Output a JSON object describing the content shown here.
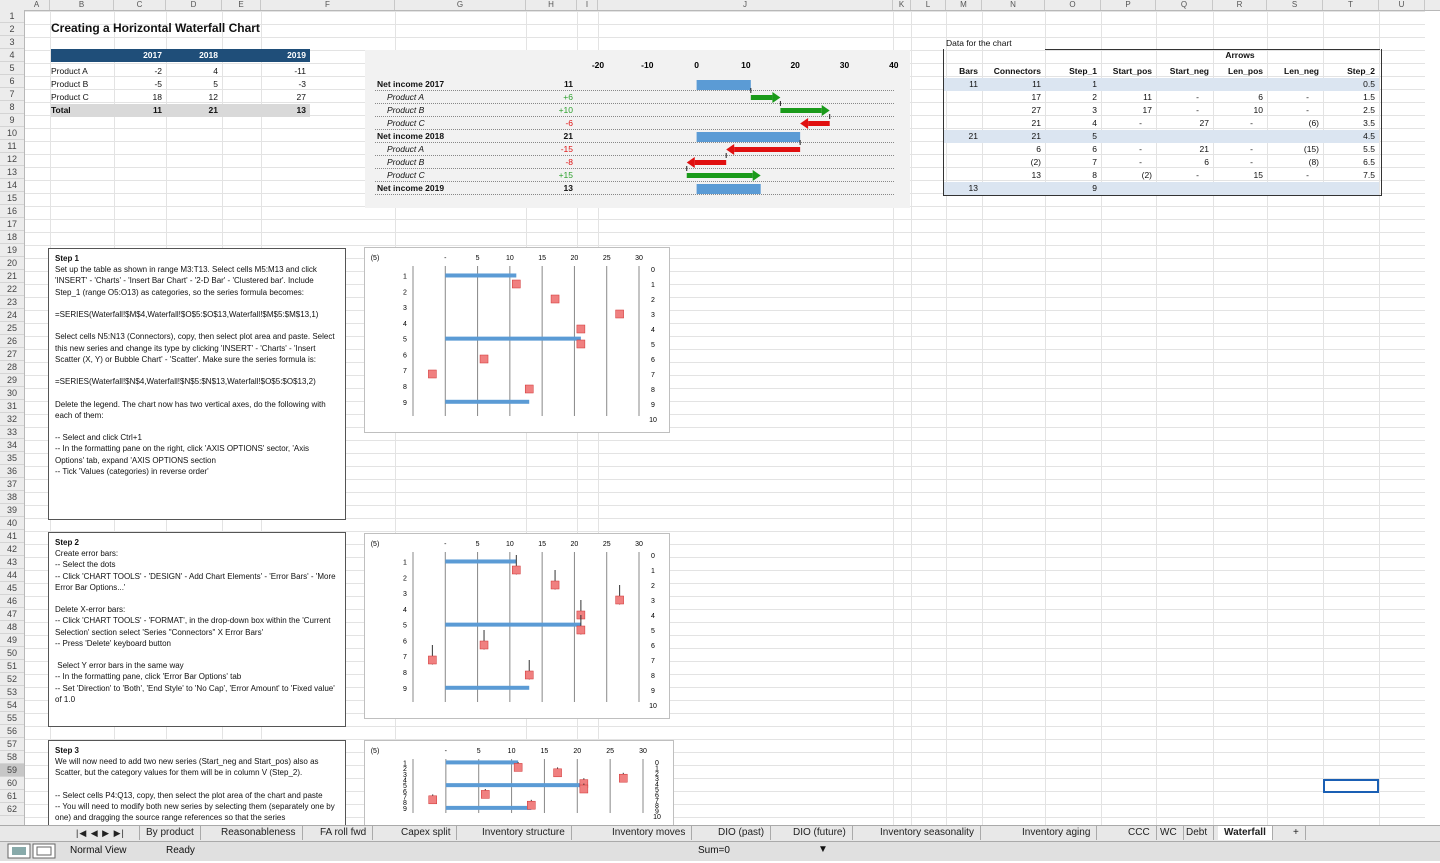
{
  "columns": [
    "A",
    "B",
    "C",
    "D",
    "E",
    "F",
    "G",
    "H",
    "I",
    "J",
    "K",
    "L",
    "M",
    "N",
    "O",
    "P",
    "Q",
    "R",
    "S",
    "T",
    "U"
  ],
  "rows": [
    "1",
    "2",
    "3",
    "4",
    "5",
    "6",
    "7",
    "8",
    "9",
    "10",
    "11",
    "12",
    "13",
    "14",
    "15",
    "16",
    "17",
    "18",
    "19",
    "20",
    "21",
    "22",
    "23",
    "24",
    "25",
    "26",
    "27",
    "28",
    "29",
    "30",
    "31",
    "32",
    "33",
    "34",
    "35",
    "36",
    "37",
    "38",
    "39",
    "40",
    "41",
    "42",
    "43",
    "44",
    "45",
    "46",
    "47",
    "48",
    "49",
    "50",
    "51",
    "52",
    "53",
    "54",
    "55",
    "56",
    "57",
    "58",
    "59",
    "60",
    "61",
    "62"
  ],
  "sheet_title": "Creating a Horizontal Waterfall Chart",
  "summary_table": {
    "years": [
      "2017",
      "2018",
      "2019"
    ],
    "rows": [
      {
        "label": "Product A",
        "v": [
          "-2",
          "4",
          "-11"
        ]
      },
      {
        "label": "Product B",
        "v": [
          "-5",
          "5",
          "-3"
        ]
      },
      {
        "label": "Product C",
        "v": [
          "18",
          "12",
          "27"
        ]
      },
      {
        "label": "Total",
        "v": [
          "11",
          "21",
          "13"
        ]
      }
    ]
  },
  "waterfall": {
    "axis_ticks": [
      "-20",
      "-10",
      "0",
      "10",
      "20",
      "30",
      "40"
    ],
    "rows": [
      {
        "label": "Net income 2017",
        "value": "11"
      },
      {
        "label": "Product A",
        "value": "+6"
      },
      {
        "label": "Product B",
        "value": "+10"
      },
      {
        "label": "Product C",
        "value": "-6"
      },
      {
        "label": "Net income 2018",
        "value": "21"
      },
      {
        "label": "Product A",
        "value": "-15"
      },
      {
        "label": "Product B",
        "value": "-8"
      },
      {
        "label": "Product C",
        "value": "+15"
      },
      {
        "label": "Net income 2019",
        "value": "13"
      }
    ],
    "colors": {
      "bar": "#5b9bd5",
      "pos": "#1a9a1a",
      "neg": "#e01010",
      "pos_text": "#2ca02c",
      "neg_text": "#e01010"
    }
  },
  "data_table": {
    "caption": "Data for the chart",
    "group_header": "Arrows",
    "headers": [
      "Bars",
      "Connectors",
      "Step_1",
      "Start_pos",
      "Start_neg",
      "Len_pos",
      "Len_neg",
      "Step_2"
    ],
    "rows": [
      [
        "11",
        "11",
        "1",
        "",
        "",
        "",
        "",
        "0.5"
      ],
      [
        "",
        "17",
        "2",
        "11",
        "-",
        "6",
        "-",
        "1.5"
      ],
      [
        "",
        "27",
        "3",
        "17",
        "-",
        "10",
        "-",
        "2.5"
      ],
      [
        "",
        "21",
        "4",
        "-",
        "27",
        "-",
        "(6)",
        "3.5"
      ],
      [
        "21",
        "21",
        "5",
        "",
        "",
        "",
        "",
        "4.5"
      ],
      [
        "",
        "6",
        "6",
        "-",
        "21",
        "-",
        "(15)",
        "5.5"
      ],
      [
        "",
        "(2)",
        "7",
        "-",
        "6",
        "-",
        "(8)",
        "6.5"
      ],
      [
        "",
        "13",
        "8",
        "(2)",
        "-",
        "15",
        "-",
        "7.5"
      ],
      [
        "13",
        "",
        "9",
        "",
        "",
        "",
        "",
        ""
      ]
    ]
  },
  "steps": [
    {
      "title": "Step 1",
      "text": "Set up the table as shown in range M3:T13. Select cells M5:M13 and click 'INSERT' - 'Charts' - 'Insert Bar Chart' - '2-D Bar' - 'Clustered bar'. Include Step_1 (range O5:O13) as categories, so the series formula becomes:\n\n=SERIES(Waterfall!$M$4,Waterfall!$O$5:$O$13,Waterfall!$M$5:$M$13,1)\n\nSelect cells N5:N13 (Connectors), copy, then select plot area and paste. Select this new series and change its type by clicking 'INSERT' - 'Charts' - 'Insert Scatter (X, Y) or Bubble Chart' - 'Scatter'. Make sure the series formula is:\n\n=SERIES(Waterfall!$N$4,Waterfall!$N$5:$N$13,Waterfall!$O$5:$O$13,2)\n\nDelete the legend. The chart now has two vertical axes, do the following with each of them:\n\n-- Select and click Ctrl+1\n-- In the formatting pane on the right, click 'AXIS OPTIONS' sector, 'Axis Options' tab, expand 'AXIS OPTIONS section\n-- Tick 'Values (categories) in reverse order'"
    },
    {
      "title": "Step 2",
      "text": "Create error bars:\n-- Select the dots\n-- Click 'CHART TOOLS' - 'DESIGN' - Add Chart Elements' - 'Error Bars' - 'More Error Bar Options...'\n\nDelete X-error bars:\n-- Click 'CHART TOOLS' - 'FORMAT', in the drop-down box within the 'Current Selection' section select 'Series \"Connectors\" X Error Bars'\n-- Press 'Delete' keyboard button\n\n Select Y error bars in the same way\n-- In the formatting pane, click 'Error Bar Options' tab\n-- Set 'Direction' to 'Both', 'End Style' to 'No Cap', 'Error Amount' to 'Fixed value' of 1.0"
    },
    {
      "title": "Step 3",
      "text": "We will now need to add two new series (Start_neg and Start_pos) also as Scatter, but the category values for them will be in column V (Step_2).\n\n-- Select cells P4:Q13, copy, then select the plot area of the chart and paste\n-- You will need to modify both new series by selecting them (separately one by one) and dragging the source range references so that the series"
    }
  ],
  "mini_chart": {
    "top_ticks": [
      "(5)",
      "-",
      "5",
      "10",
      "15",
      "20",
      "25",
      "30"
    ],
    "left_ticks": [
      "1",
      "2",
      "3",
      "4",
      "5",
      "6",
      "7",
      "8",
      "9"
    ],
    "right_ticks": [
      "0",
      "1",
      "2",
      "3",
      "4",
      "5",
      "6",
      "7",
      "8",
      "9",
      "10"
    ],
    "colors": {
      "bar": "#5b9bd5",
      "dot": "#f08080",
      "dot_border": "#d03030"
    }
  },
  "tabs": [
    "By product",
    "Reasonableness",
    "FA roll fwd",
    "Capex split",
    "Inventory structure",
    "Inventory moves",
    "DIO (past)",
    "DIO (future)",
    "Inventory seasonality",
    "Inventory aging",
    "CCC",
    "WC",
    "Debt",
    "Waterfall",
    "+"
  ],
  "active_tab": "Waterfall",
  "status": {
    "view": "Normal View",
    "ready": "Ready",
    "sum": "Sum=0"
  }
}
